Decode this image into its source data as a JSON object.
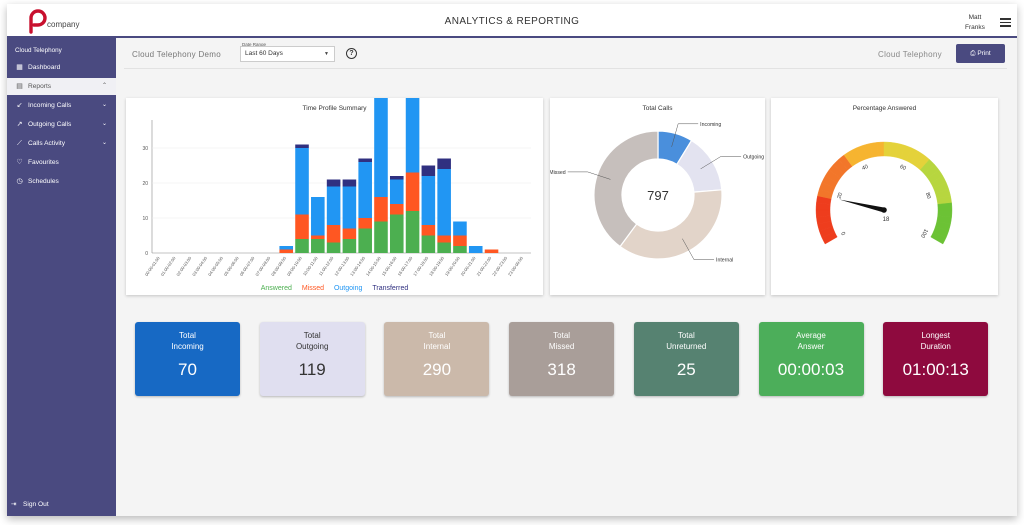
{
  "app": {
    "logo_text": "company",
    "title": "ANALYTICS & REPORTING",
    "user_first": "Matt",
    "user_last": "Franks"
  },
  "sidebar": {
    "title": "Cloud Telephony",
    "items": [
      {
        "label": "Dashboard",
        "icon": "dashboard-icon"
      },
      {
        "label": "Reports",
        "icon": "reports-icon"
      },
      {
        "label": "Incoming Calls",
        "icon": "incoming-arrow-icon"
      },
      {
        "label": "Outgoing Calls",
        "icon": "outgoing-arrow-icon"
      },
      {
        "label": "Calls Activity",
        "icon": "trend-icon"
      },
      {
        "label": "Favourites",
        "icon": "heart-icon"
      },
      {
        "label": "Schedules",
        "icon": "clock-icon"
      }
    ],
    "signout": "Sign Out"
  },
  "filter": {
    "title": "Cloud Telephony Demo",
    "date_label": "Date Range",
    "date_value": "Last 60 Days",
    "right_label": "Cloud Telephony",
    "print": "Print"
  },
  "chart_data": [
    {
      "type": "bar",
      "title": "Time Profile Summary",
      "categories": [
        "00:00-01:00",
        "01:00-02:00",
        "02:00-03:00",
        "03:00-04:00",
        "04:00-05:00",
        "05:00-06:00",
        "06:00-07:00",
        "07:00-08:00",
        "08:00-09:00",
        "09:00-10:00",
        "10:00-11:00",
        "11:00-12:00",
        "12:00-13:00",
        "13:00-14:00",
        "14:00-15:00",
        "15:00-16:00",
        "16:00-17:00",
        "17:00-18:00",
        "18:00-19:00",
        "19:00-20:00",
        "20:00-21:00",
        "21:00-22:00",
        "22:00-23:00",
        "23:00-00:00"
      ],
      "series": [
        {
          "name": "Answered",
          "color": "#4caf50",
          "values": [
            0,
            0,
            0,
            0,
            0,
            0,
            0,
            0,
            0,
            4,
            4,
            3,
            4,
            7,
            9,
            11,
            12,
            5,
            3,
            2,
            0,
            0,
            0,
            0
          ]
        },
        {
          "name": "Missed",
          "color": "#ff5722",
          "values": [
            0,
            0,
            0,
            0,
            0,
            0,
            0,
            0,
            1,
            7,
            1,
            5,
            3,
            3,
            7,
            3,
            11,
            3,
            2,
            3,
            0,
            1,
            0,
            0
          ]
        },
        {
          "name": "Outgoing",
          "color": "#2196f3",
          "values": [
            0,
            0,
            0,
            0,
            0,
            0,
            0,
            0,
            1,
            19,
            11,
            11,
            12,
            16,
            29,
            7,
            46,
            14,
            19,
            4,
            2,
            0,
            0,
            0
          ]
        },
        {
          "name": "Transferred",
          "color": "#303080",
          "values": [
            0,
            0,
            0,
            0,
            0,
            0,
            0,
            0,
            0,
            1,
            0,
            2,
            2,
            1,
            10,
            1,
            6,
            3,
            3,
            0,
            0,
            0,
            0,
            0
          ]
        }
      ],
      "ylim": [
        0,
        38
      ],
      "yticks": [
        0,
        10,
        20,
        30
      ]
    },
    {
      "type": "pie",
      "title": "Total Calls",
      "center_value": "797",
      "slices": [
        {
          "label": "Incoming",
          "value": 70,
          "color": "#4a8fdc"
        },
        {
          "label": "Outgoing",
          "value": 119,
          "color": "#e3e3f0"
        },
        {
          "label": "Internal",
          "value": 290,
          "color": "#e2d4c9"
        },
        {
          "label": "Missed",
          "value": 318,
          "color": "#c6bfbc"
        }
      ]
    },
    {
      "type": "gauge",
      "title": "Percentage Answered",
      "value": 18,
      "min": 0,
      "max": 100,
      "ticks": [
        "0",
        "20",
        "40",
        "60",
        "80",
        "100"
      ]
    }
  ],
  "stats": [
    {
      "label1": "Total",
      "label2": "Incoming",
      "value": "70",
      "color": "#1769c4"
    },
    {
      "label1": "Total",
      "label2": "Outgoing",
      "value": "119",
      "color": "#e0dff0"
    },
    {
      "label1": "Total",
      "label2": "Internal",
      "value": "290",
      "color": "#cbb9aa"
    },
    {
      "label1": "Total",
      "label2": "Missed",
      "value": "318",
      "color": "#a99e99"
    },
    {
      "label1": "Total",
      "label2": "Unreturned",
      "value": "25",
      "color": "#568271"
    },
    {
      "label1": "Average",
      "label2": "Answer",
      "value": "00:00:03",
      "color": "#4cae5a"
    },
    {
      "label1": "Longest",
      "label2": "Duration",
      "value": "01:00:13",
      "color": "#8e0a3e"
    }
  ]
}
